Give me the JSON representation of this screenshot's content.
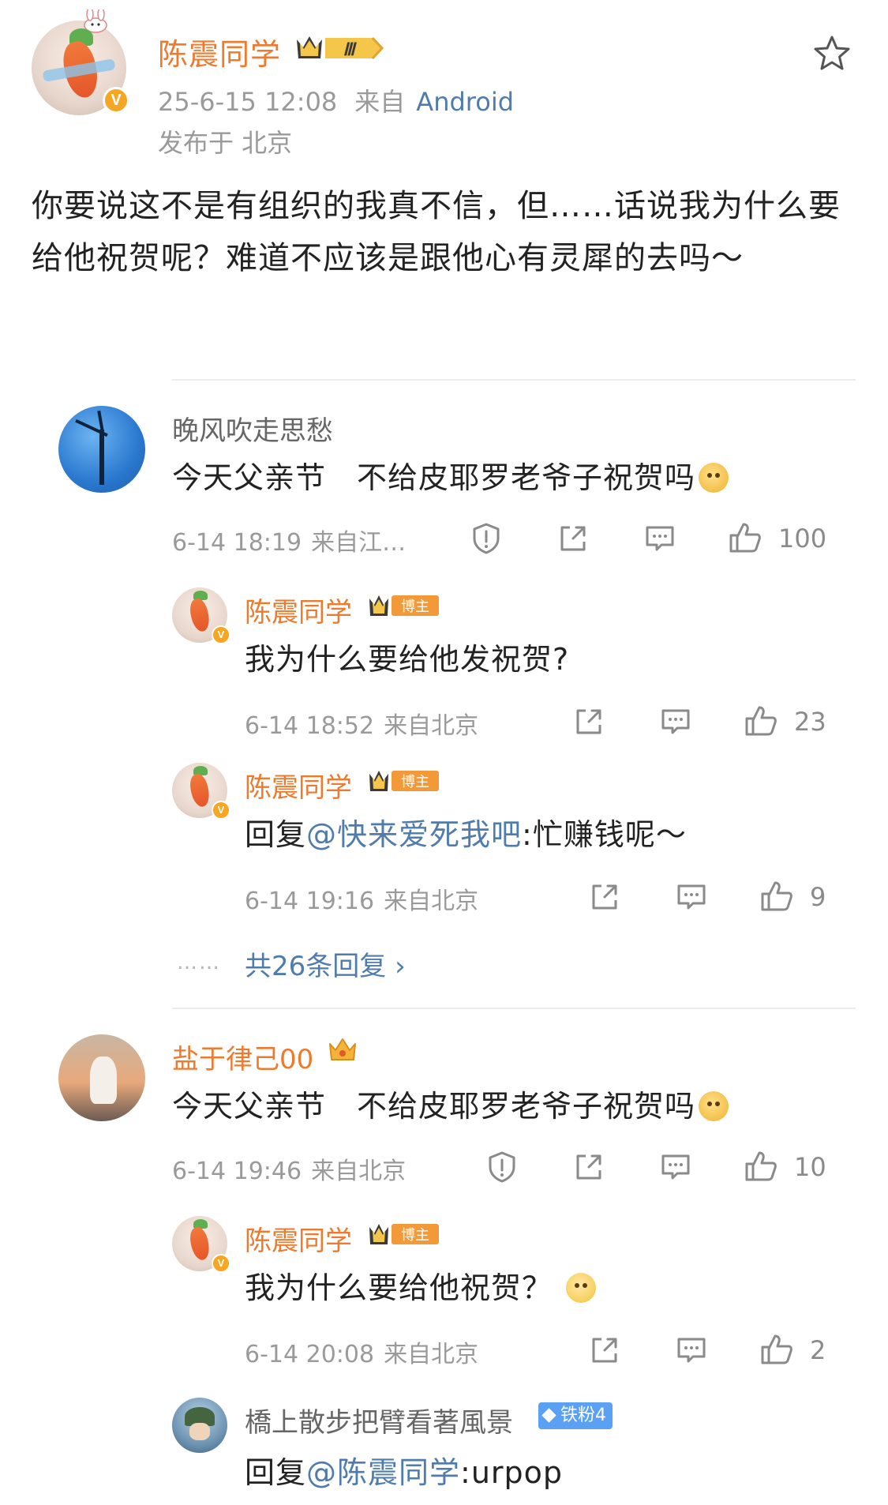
{
  "post": {
    "author": "陈震同学",
    "time": "25-6-15 12:08",
    "from_label": "来自",
    "source_app": "Android",
    "location": "发布于 北京",
    "vip_level": "Ⅲ",
    "body": "你要说这不是有组织的我真不信，但……话说我为什么要给他祝贺呢？难道不应该是跟他心有灵犀的去吗～"
  },
  "comments": [
    {
      "user": "晚风吹走思愁",
      "text": "今天父亲节　不给皮耶罗老爷子祝贺吗",
      "time": "6-14 18:19",
      "loc": "来自江…",
      "likes": "100",
      "replies": [
        {
          "user": "陈震同学",
          "tag": "博主",
          "text": "我为什么要给他发祝贺?",
          "time": "6-14 18:52",
          "loc": "来自北京",
          "likes": "23"
        },
        {
          "user": "陈震同学",
          "tag": "博主",
          "reply_prefix": "回复",
          "mention": "@快来爱死我吧",
          "text": ":忙赚钱呢～",
          "time": "6-14 19:16",
          "loc": "来自北京",
          "likes": "9"
        }
      ],
      "more_dots": "……",
      "more_replies": "共26条回复 ›"
    },
    {
      "user": "盐于律己00",
      "text": "今天父亲节　不给皮耶罗老爷子祝贺吗",
      "time": "6-14 19:46",
      "loc": "来自北京",
      "likes": "10",
      "replies": [
        {
          "user": "陈震同学",
          "tag": "博主",
          "text": "我为什么要给他祝贺？",
          "time": "6-14 20:08",
          "loc": "来自北京",
          "likes": "2"
        },
        {
          "user": "橋上散步把臂看著風景",
          "tag": "铁粉4",
          "reply_prefix": "回复",
          "mention": "@陈震同学",
          "text": ":urpop"
        }
      ]
    }
  ],
  "icons": {
    "favorite": "star-outline-icon",
    "report": "shield-exclamation-icon",
    "share": "share-square-icon",
    "comment": "comment-bubble-icon",
    "like": "thumbs-up-icon"
  },
  "colors": {
    "author_orange": "#ee7a2e",
    "link_blue": "#4f7cad",
    "meta_gray": "#9a9a9a",
    "verified_gold": "#f6a623",
    "fan_badge_blue": "#5aa0f3"
  }
}
